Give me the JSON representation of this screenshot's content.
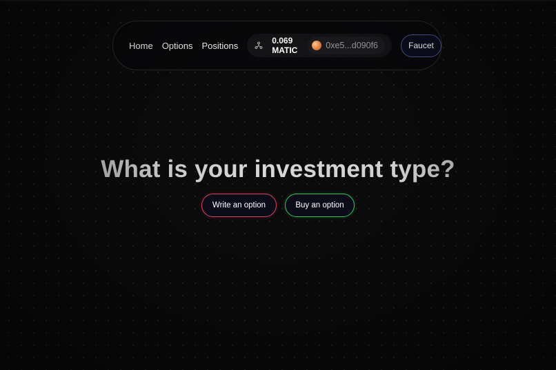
{
  "nav": {
    "links": [
      {
        "label": "Home"
      },
      {
        "label": "Options"
      },
      {
        "label": "Positions"
      }
    ],
    "wallet": {
      "chain_icon": "polygon-chain-icon",
      "balance_amount": "0.069",
      "balance_unit": "MATIC",
      "address": "0xe5...d090f6"
    },
    "faucet_label": "Faucet"
  },
  "hero": {
    "title": "What is your investment type?",
    "write_label": "Write an option",
    "buy_label": "Buy an option"
  },
  "colors": {
    "background": "#0b0b0b",
    "write_border": "#d8455a",
    "buy_border": "#3ec15a",
    "faucet_border": "#4a5a96"
  }
}
